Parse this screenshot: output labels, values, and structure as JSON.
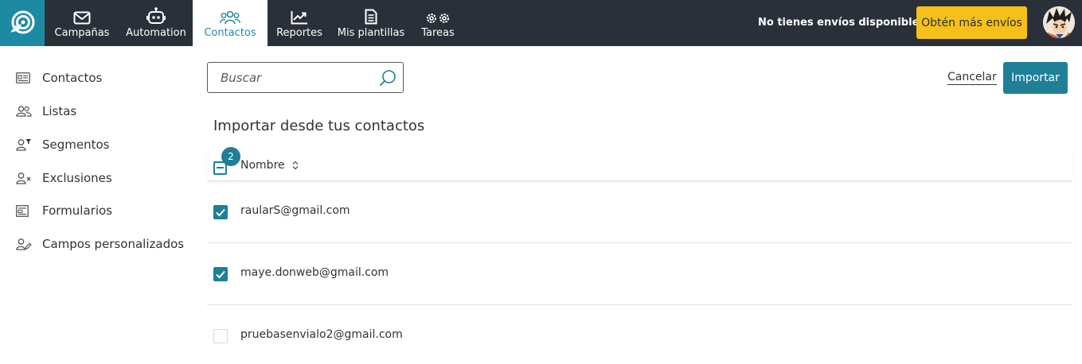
{
  "topbar": {
    "nav": [
      {
        "label": "Campañas",
        "icon": "envelope-icon"
      },
      {
        "label": "Automation",
        "icon": "robot-icon"
      },
      {
        "label": "Contactos",
        "icon": "users-icon",
        "active": true
      },
      {
        "label": "Reportes",
        "icon": "chart-trend-icon"
      },
      {
        "label": "Mis plantillas",
        "icon": "document-icon"
      },
      {
        "label": "Tareas",
        "icon": "gears-icon"
      }
    ],
    "no_envios": "No tienes envíos disponibles.",
    "obten_mas": "Obtén más envíos",
    "accent_color": "#1c8aa3",
    "cta_color": "#f5c01a"
  },
  "sidebar": {
    "items": [
      {
        "label": "Contactos",
        "icon": "id-card-icon"
      },
      {
        "label": "Listas",
        "icon": "users-icon"
      },
      {
        "label": "Segmentos",
        "icon": "user-filter-icon"
      },
      {
        "label": "Exclusiones",
        "icon": "user-x-icon"
      },
      {
        "label": "Formularios",
        "icon": "form-icon"
      },
      {
        "label": "Campos personalizados",
        "icon": "user-edit-icon"
      }
    ]
  },
  "search": {
    "placeholder": "Buscar",
    "value": ""
  },
  "actions": {
    "cancel_label": "Cancelar",
    "import_label": "Importar"
  },
  "main": {
    "title": "Importar desde tus contactos",
    "selected_count": "2",
    "column_name": "Nombre",
    "rows": [
      {
        "email": "raularS@gmail.com",
        "checked": true
      },
      {
        "email": "maye.donweb@gmail.com",
        "checked": true
      },
      {
        "email": "pruebasenvialo2@gmail.com",
        "checked": false
      }
    ]
  }
}
